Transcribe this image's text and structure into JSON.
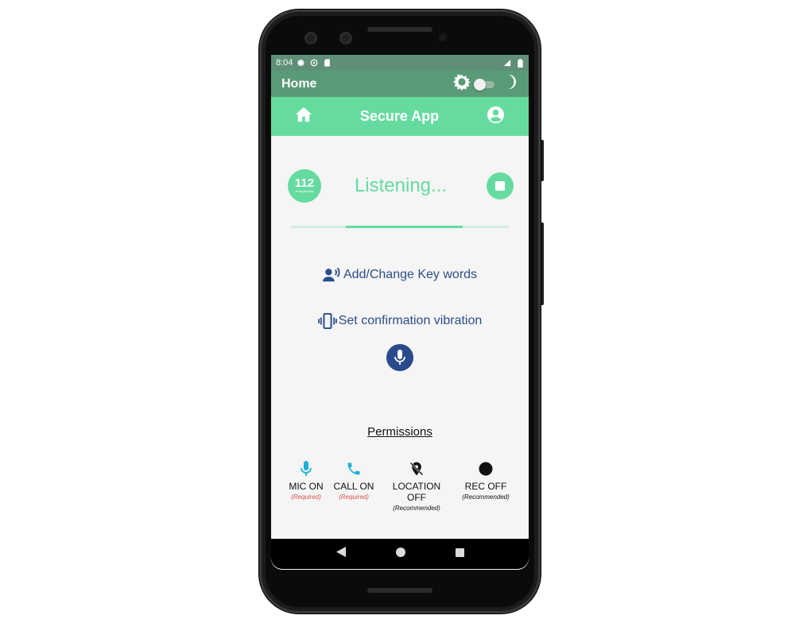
{
  "status_bar": {
    "time": "8:04"
  },
  "title_bar": {
    "title": "Home"
  },
  "app_bar": {
    "title": "Secure App"
  },
  "logo": {
    "number": "112",
    "subtitle": "emergências"
  },
  "listening": {
    "text": "Listening...",
    "progress_start": 0.25,
    "progress_end": 0.79
  },
  "actions": {
    "keywords_label": "Add/Change Key words",
    "vibration_label": "Set confirmation vibration"
  },
  "permissions": {
    "title": "Permissions",
    "items": [
      {
        "label": "MIC ON",
        "note": "(Required)",
        "icon": "mic-icon",
        "color": "#1ab0d8",
        "note_color": "#d9534f"
      },
      {
        "label": "CALL ON",
        "note": "(Required)",
        "icon": "phone-icon",
        "color": "#1ab0d8",
        "note_color": "#d9534f"
      },
      {
        "label": "LOCATION OFF",
        "note": "(Recommended)",
        "icon": "location-off-icon",
        "color": "#111111",
        "note_color": "#111111"
      },
      {
        "label": "REC OFF",
        "note": "(Recommended)",
        "icon": "record-icon",
        "color": "#111111",
        "note_color": "#111111"
      }
    ]
  },
  "colors": {
    "accent": "#66dba0",
    "title_bar": "#5a9b77",
    "action_text": "#2b4d8a"
  }
}
